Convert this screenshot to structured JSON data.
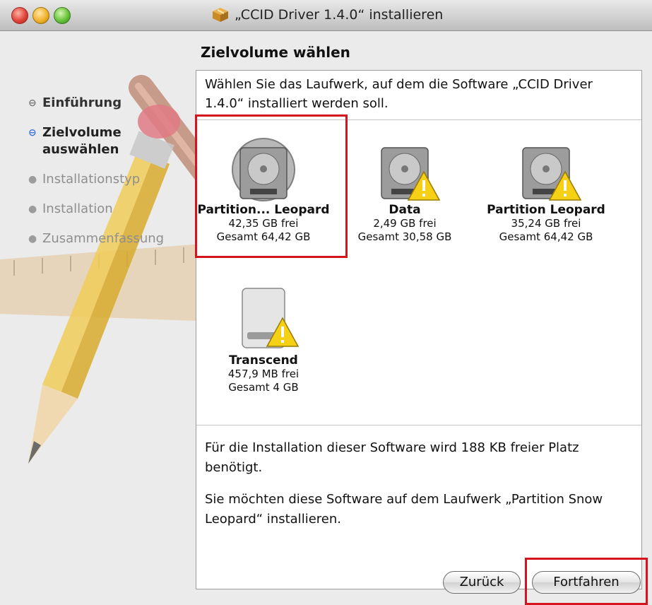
{
  "window": {
    "title": "„CCID Driver 1.4.0“ installieren"
  },
  "sidebar": {
    "steps": [
      {
        "label": "Einführung",
        "state": "done"
      },
      {
        "label": "Zielvolume auswählen",
        "state": "current"
      },
      {
        "label": "Installationstyp",
        "state": "future"
      },
      {
        "label": "Installation",
        "state": "future"
      },
      {
        "label": "Zusammenfassung",
        "state": "future"
      }
    ]
  },
  "main": {
    "heading": "Zielvolume wählen",
    "intro": "Wählen Sie das Laufwerk, auf dem die Software „CCID Driver 1.4.0“ installiert werden soll.",
    "volumes": [
      {
        "name": "Partition... Leopard",
        "free": "42,35 GB frei",
        "total": "Gesamt 64,42 GB",
        "icon": "hard-drive-icon",
        "selected": true,
        "warning": false
      },
      {
        "name": "Data",
        "free": "2,49 GB frei",
        "total": "Gesamt 30,58 GB",
        "icon": "hard-drive-icon",
        "selected": false,
        "warning": true
      },
      {
        "name": "Partition Leopard",
        "free": "35,24 GB frei",
        "total": "Gesamt 64,42 GB",
        "icon": "hard-drive-icon",
        "selected": false,
        "warning": true
      },
      {
        "name": "Transcend",
        "free": "457,9 MB frei",
        "total": "Gesamt 4 GB",
        "icon": "external-drive-icon",
        "selected": false,
        "warning": true
      }
    ],
    "info_space": "Für die Installation dieser Software wird 188 KB freier Platz benötigt.",
    "info_target": "Sie möchten diese Software auf dem Laufwerk „Partition Snow Leopard“ installieren."
  },
  "buttons": {
    "back": "Zurück",
    "continue": "Fortfahren"
  },
  "colors": {
    "highlight": "#d6141e",
    "current_step_bullet": "#3a74d8"
  }
}
